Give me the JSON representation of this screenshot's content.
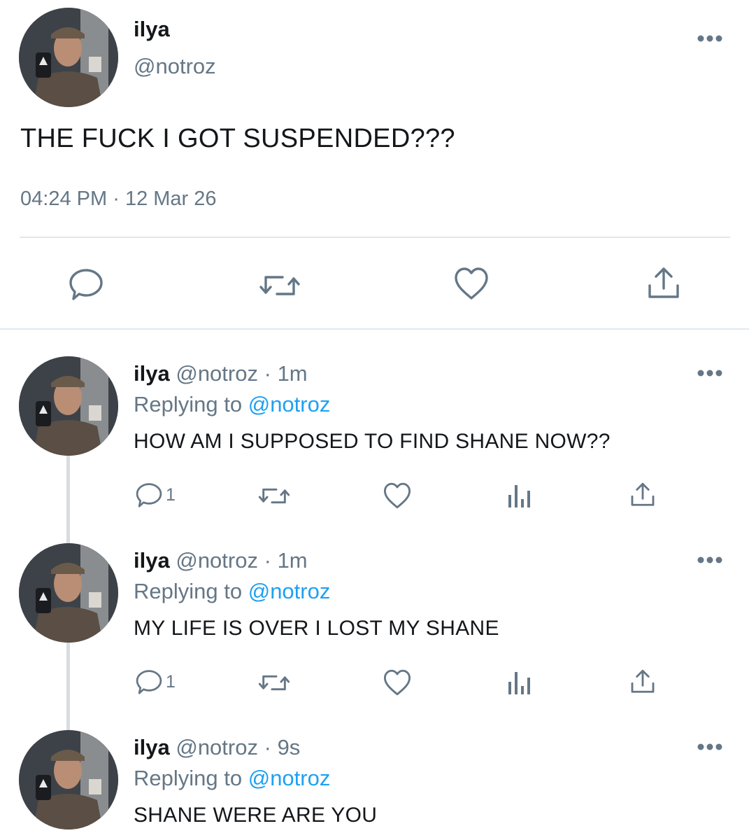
{
  "main_tweet": {
    "name": "ilya",
    "handle": "@notroz",
    "text": "THE FUCK I GOT SUSPENDED???",
    "time": "04:24 PM",
    "separator": "·",
    "date": "12 Mar 26",
    "actions": [
      "reply-icon",
      "retweet-icon",
      "like-icon",
      "share-icon"
    ]
  },
  "replies": [
    {
      "name": "ilya",
      "handle": "@notroz",
      "dot": "·",
      "time": "1m",
      "replying_label": "Replying to",
      "replying_to": "@notroz",
      "text": "HOW AM I SUPPOSED TO FIND SHANE NOW??",
      "reply_count": "1"
    },
    {
      "name": "ilya",
      "handle": "@notroz",
      "dot": "·",
      "time": "1m",
      "replying_label": "Replying to",
      "replying_to": "@notroz",
      "text": "MY LIFE IS OVER I LOST MY SHANE",
      "reply_count": "1"
    },
    {
      "name": "ilya",
      "handle": "@notroz",
      "dot": "·",
      "time": "9s",
      "replying_label": "Replying to",
      "replying_to": "@notroz",
      "text": "SHANE WERE ARE YOU"
    }
  ],
  "colors": {
    "text_primary": "#14171a",
    "text_secondary": "#657786",
    "link": "#1da1f2",
    "icon": "#657786",
    "divider": "#e1e8ed"
  }
}
